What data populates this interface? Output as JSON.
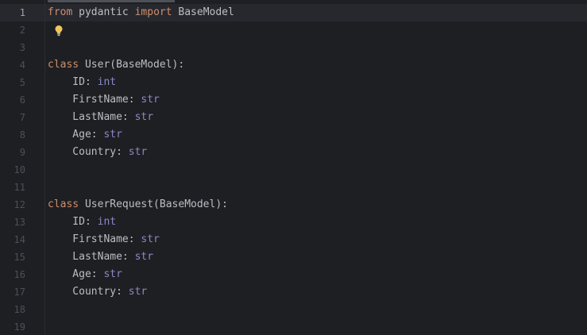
{
  "editor": {
    "lines": [
      {
        "n": "1",
        "tokens": [
          {
            "t": "from",
            "c": "kw"
          },
          {
            "t": " pydantic ",
            "c": "id"
          },
          {
            "t": "import",
            "c": "kw"
          },
          {
            "t": " BaseModel",
            "c": "id"
          }
        ]
      },
      {
        "n": "2",
        "tokens": [],
        "icon": "lightbulb-icon"
      },
      {
        "n": "3",
        "tokens": []
      },
      {
        "n": "4",
        "tokens": [
          {
            "t": "class",
            "c": "kw"
          },
          {
            "t": " User(BaseModel):",
            "c": "id"
          }
        ]
      },
      {
        "n": "5",
        "tokens": [
          {
            "t": "    ID: ",
            "c": "id"
          },
          {
            "t": "int",
            "c": "ty"
          }
        ]
      },
      {
        "n": "6",
        "tokens": [
          {
            "t": "    FirstName: ",
            "c": "id"
          },
          {
            "t": "str",
            "c": "ty"
          }
        ]
      },
      {
        "n": "7",
        "tokens": [
          {
            "t": "    LastName: ",
            "c": "id"
          },
          {
            "t": "str",
            "c": "ty"
          }
        ]
      },
      {
        "n": "8",
        "tokens": [
          {
            "t": "    Age: ",
            "c": "id"
          },
          {
            "t": "str",
            "c": "ty"
          }
        ]
      },
      {
        "n": "9",
        "tokens": [
          {
            "t": "    Country: ",
            "c": "id"
          },
          {
            "t": "str",
            "c": "ty"
          }
        ]
      },
      {
        "n": "10",
        "tokens": []
      },
      {
        "n": "11",
        "tokens": []
      },
      {
        "n": "12",
        "tokens": [
          {
            "t": "class",
            "c": "kw"
          },
          {
            "t": " UserRequest(BaseModel):",
            "c": "id"
          }
        ]
      },
      {
        "n": "13",
        "tokens": [
          {
            "t": "    ID: ",
            "c": "id"
          },
          {
            "t": "int",
            "c": "ty"
          }
        ]
      },
      {
        "n": "14",
        "tokens": [
          {
            "t": "    FirstName: ",
            "c": "id"
          },
          {
            "t": "str",
            "c": "ty"
          }
        ]
      },
      {
        "n": "15",
        "tokens": [
          {
            "t": "    LastName: ",
            "c": "id"
          },
          {
            "t": "str",
            "c": "ty"
          }
        ]
      },
      {
        "n": "16",
        "tokens": [
          {
            "t": "    Age: ",
            "c": "id"
          },
          {
            "t": "str",
            "c": "ty"
          }
        ]
      },
      {
        "n": "17",
        "tokens": [
          {
            "t": "    Country: ",
            "c": "id"
          },
          {
            "t": "str",
            "c": "ty"
          }
        ]
      },
      {
        "n": "18",
        "tokens": []
      },
      {
        "n": "19",
        "tokens": []
      }
    ],
    "current_line": "1"
  },
  "colors": {
    "background": "#1e1f22",
    "keyword": "#cf8e6d",
    "identifier": "#bcbec4",
    "type": "#8888c6",
    "line_number": "#4b5059",
    "line_number_current": "#a1a3ab",
    "current_line_bg": "#26282e",
    "lightbulb": "#f2c55c"
  }
}
